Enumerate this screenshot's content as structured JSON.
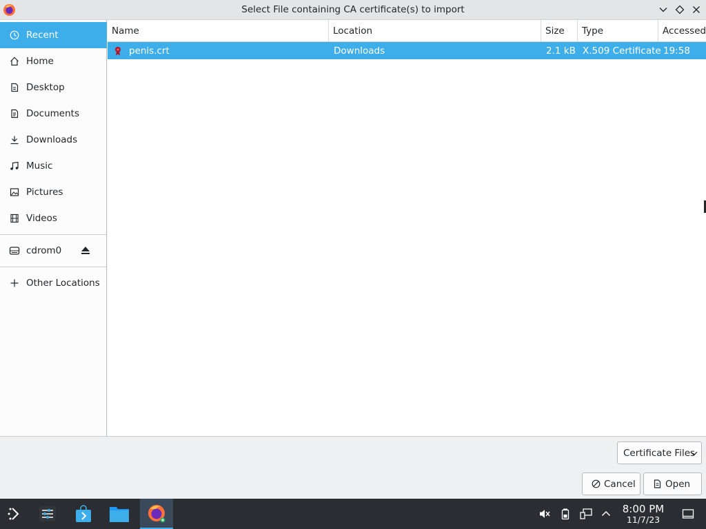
{
  "window": {
    "title": "Select File containing CA certificate(s) to import",
    "app_icon": "firefox-icon",
    "controls": [
      "minimize",
      "maximize",
      "close"
    ]
  },
  "sidebar": {
    "items": [
      {
        "label": "Recent",
        "icon": "clock-icon",
        "active": true
      },
      {
        "label": "Home",
        "icon": "home-icon"
      },
      {
        "label": "Desktop",
        "icon": "desktop-icon"
      },
      {
        "label": "Documents",
        "icon": "document-icon"
      },
      {
        "label": "Downloads",
        "icon": "download-icon"
      },
      {
        "label": "Music",
        "icon": "music-icon"
      },
      {
        "label": "Pictures",
        "icon": "picture-icon"
      },
      {
        "label": "Videos",
        "icon": "video-icon"
      }
    ],
    "devices": [
      {
        "label": "cdrom0",
        "icon": "drive-icon",
        "eject_icon": "eject-icon"
      }
    ],
    "other_locations": {
      "label": "Other Locations",
      "icon": "plus-icon"
    }
  },
  "file_list": {
    "columns": [
      "Name",
      "Location",
      "Size",
      "Type",
      "Accessed"
    ],
    "rows": [
      {
        "name": "penis.crt",
        "location": "Downloads",
        "size": "2.1 kB",
        "type": "X.509 Certificate",
        "accessed": "19:58",
        "selected": true
      }
    ]
  },
  "filter": {
    "value": "Certificate Files"
  },
  "buttons": {
    "cancel": "Cancel",
    "open": "Open"
  },
  "taskbar": {
    "apps": [
      "app-launcher-icon",
      "system-settings-icon",
      "discover-store-icon",
      "file-manager-icon",
      "firefox-icon"
    ],
    "tray": [
      "volume-muted-icon",
      "battery-icon",
      "network-icon",
      "expand-tray-icon"
    ],
    "time": "8:00 PM",
    "date": "11/7/23",
    "show_desktop_icon": "show-desktop-icon"
  },
  "colors": {
    "accent": "#3daee9",
    "taskbar": "#2a2e32",
    "background": "#eff0f1"
  }
}
